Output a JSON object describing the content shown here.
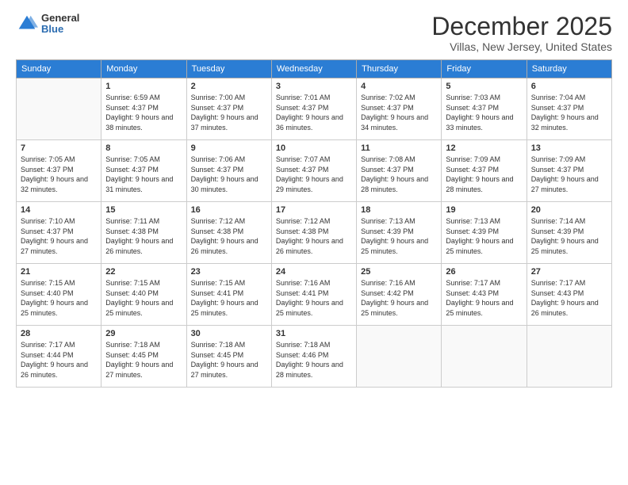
{
  "logo": {
    "general": "General",
    "blue": "Blue"
  },
  "title": "December 2025",
  "subtitle": "Villas, New Jersey, United States",
  "weekdays": [
    "Sunday",
    "Monday",
    "Tuesday",
    "Wednesday",
    "Thursday",
    "Friday",
    "Saturday"
  ],
  "weeks": [
    [
      {
        "day": "",
        "sunrise": "",
        "sunset": "",
        "daylight": ""
      },
      {
        "day": "1",
        "sunrise": "Sunrise: 6:59 AM",
        "sunset": "Sunset: 4:37 PM",
        "daylight": "Daylight: 9 hours and 38 minutes."
      },
      {
        "day": "2",
        "sunrise": "Sunrise: 7:00 AM",
        "sunset": "Sunset: 4:37 PM",
        "daylight": "Daylight: 9 hours and 37 minutes."
      },
      {
        "day": "3",
        "sunrise": "Sunrise: 7:01 AM",
        "sunset": "Sunset: 4:37 PM",
        "daylight": "Daylight: 9 hours and 36 minutes."
      },
      {
        "day": "4",
        "sunrise": "Sunrise: 7:02 AM",
        "sunset": "Sunset: 4:37 PM",
        "daylight": "Daylight: 9 hours and 34 minutes."
      },
      {
        "day": "5",
        "sunrise": "Sunrise: 7:03 AM",
        "sunset": "Sunset: 4:37 PM",
        "daylight": "Daylight: 9 hours and 33 minutes."
      },
      {
        "day": "6",
        "sunrise": "Sunrise: 7:04 AM",
        "sunset": "Sunset: 4:37 PM",
        "daylight": "Daylight: 9 hours and 32 minutes."
      }
    ],
    [
      {
        "day": "7",
        "sunrise": "Sunrise: 7:05 AM",
        "sunset": "Sunset: 4:37 PM",
        "daylight": "Daylight: 9 hours and 32 minutes."
      },
      {
        "day": "8",
        "sunrise": "Sunrise: 7:05 AM",
        "sunset": "Sunset: 4:37 PM",
        "daylight": "Daylight: 9 hours and 31 minutes."
      },
      {
        "day": "9",
        "sunrise": "Sunrise: 7:06 AM",
        "sunset": "Sunset: 4:37 PM",
        "daylight": "Daylight: 9 hours and 30 minutes."
      },
      {
        "day": "10",
        "sunrise": "Sunrise: 7:07 AM",
        "sunset": "Sunset: 4:37 PM",
        "daylight": "Daylight: 9 hours and 29 minutes."
      },
      {
        "day": "11",
        "sunrise": "Sunrise: 7:08 AM",
        "sunset": "Sunset: 4:37 PM",
        "daylight": "Daylight: 9 hours and 28 minutes."
      },
      {
        "day": "12",
        "sunrise": "Sunrise: 7:09 AM",
        "sunset": "Sunset: 4:37 PM",
        "daylight": "Daylight: 9 hours and 28 minutes."
      },
      {
        "day": "13",
        "sunrise": "Sunrise: 7:09 AM",
        "sunset": "Sunset: 4:37 PM",
        "daylight": "Daylight: 9 hours and 27 minutes."
      }
    ],
    [
      {
        "day": "14",
        "sunrise": "Sunrise: 7:10 AM",
        "sunset": "Sunset: 4:37 PM",
        "daylight": "Daylight: 9 hours and 27 minutes."
      },
      {
        "day": "15",
        "sunrise": "Sunrise: 7:11 AM",
        "sunset": "Sunset: 4:38 PM",
        "daylight": "Daylight: 9 hours and 26 minutes."
      },
      {
        "day": "16",
        "sunrise": "Sunrise: 7:12 AM",
        "sunset": "Sunset: 4:38 PM",
        "daylight": "Daylight: 9 hours and 26 minutes."
      },
      {
        "day": "17",
        "sunrise": "Sunrise: 7:12 AM",
        "sunset": "Sunset: 4:38 PM",
        "daylight": "Daylight: 9 hours and 26 minutes."
      },
      {
        "day": "18",
        "sunrise": "Sunrise: 7:13 AM",
        "sunset": "Sunset: 4:39 PM",
        "daylight": "Daylight: 9 hours and 25 minutes."
      },
      {
        "day": "19",
        "sunrise": "Sunrise: 7:13 AM",
        "sunset": "Sunset: 4:39 PM",
        "daylight": "Daylight: 9 hours and 25 minutes."
      },
      {
        "day": "20",
        "sunrise": "Sunrise: 7:14 AM",
        "sunset": "Sunset: 4:39 PM",
        "daylight": "Daylight: 9 hours and 25 minutes."
      }
    ],
    [
      {
        "day": "21",
        "sunrise": "Sunrise: 7:15 AM",
        "sunset": "Sunset: 4:40 PM",
        "daylight": "Daylight: 9 hours and 25 minutes."
      },
      {
        "day": "22",
        "sunrise": "Sunrise: 7:15 AM",
        "sunset": "Sunset: 4:40 PM",
        "daylight": "Daylight: 9 hours and 25 minutes."
      },
      {
        "day": "23",
        "sunrise": "Sunrise: 7:15 AM",
        "sunset": "Sunset: 4:41 PM",
        "daylight": "Daylight: 9 hours and 25 minutes."
      },
      {
        "day": "24",
        "sunrise": "Sunrise: 7:16 AM",
        "sunset": "Sunset: 4:41 PM",
        "daylight": "Daylight: 9 hours and 25 minutes."
      },
      {
        "day": "25",
        "sunrise": "Sunrise: 7:16 AM",
        "sunset": "Sunset: 4:42 PM",
        "daylight": "Daylight: 9 hours and 25 minutes."
      },
      {
        "day": "26",
        "sunrise": "Sunrise: 7:17 AM",
        "sunset": "Sunset: 4:43 PM",
        "daylight": "Daylight: 9 hours and 25 minutes."
      },
      {
        "day": "27",
        "sunrise": "Sunrise: 7:17 AM",
        "sunset": "Sunset: 4:43 PM",
        "daylight": "Daylight: 9 hours and 26 minutes."
      }
    ],
    [
      {
        "day": "28",
        "sunrise": "Sunrise: 7:17 AM",
        "sunset": "Sunset: 4:44 PM",
        "daylight": "Daylight: 9 hours and 26 minutes."
      },
      {
        "day": "29",
        "sunrise": "Sunrise: 7:18 AM",
        "sunset": "Sunset: 4:45 PM",
        "daylight": "Daylight: 9 hours and 27 minutes."
      },
      {
        "day": "30",
        "sunrise": "Sunrise: 7:18 AM",
        "sunset": "Sunset: 4:45 PM",
        "daylight": "Daylight: 9 hours and 27 minutes."
      },
      {
        "day": "31",
        "sunrise": "Sunrise: 7:18 AM",
        "sunset": "Sunset: 4:46 PM",
        "daylight": "Daylight: 9 hours and 28 minutes."
      },
      {
        "day": "",
        "sunrise": "",
        "sunset": "",
        "daylight": ""
      },
      {
        "day": "",
        "sunrise": "",
        "sunset": "",
        "daylight": ""
      },
      {
        "day": "",
        "sunrise": "",
        "sunset": "",
        "daylight": ""
      }
    ]
  ]
}
